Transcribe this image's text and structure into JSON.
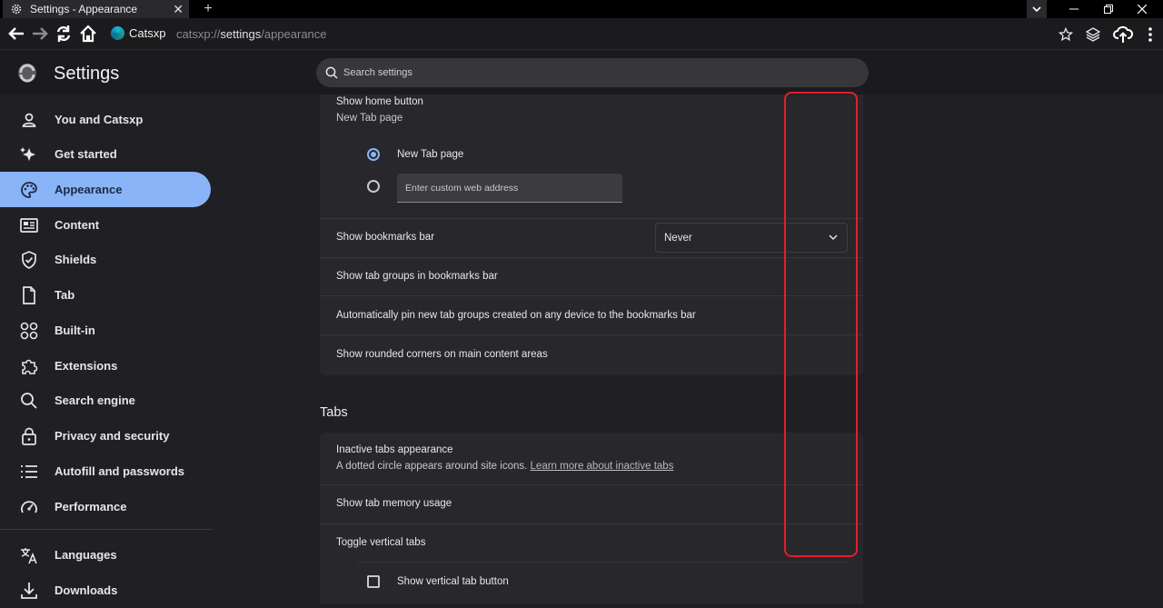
{
  "window": {
    "tab_title": "Settings - Appearance",
    "tab_close": "✕",
    "new_tab": "+"
  },
  "toolbar": {
    "brand": "Catsxp",
    "url_scheme": "catsxp://",
    "url_host": "settings",
    "url_path": "/appearance"
  },
  "header": {
    "title": "Settings",
    "search_placeholder": "Search settings"
  },
  "sidebar": {
    "items": [
      {
        "label": "You and Catsxp",
        "icon": "person-icon"
      },
      {
        "label": "Get started",
        "icon": "sparkle-icon"
      },
      {
        "label": "Appearance",
        "icon": "palette-icon",
        "active": true
      },
      {
        "label": "Content",
        "icon": "content-icon"
      },
      {
        "label": "Shields",
        "icon": "shield-icon"
      },
      {
        "label": "Tab",
        "icon": "document-icon"
      },
      {
        "label": "Built-in",
        "icon": "grid-icon"
      },
      {
        "label": "Extensions",
        "icon": "puzzle-icon"
      },
      {
        "label": "Search engine",
        "icon": "search-icon"
      },
      {
        "label": "Privacy and security",
        "icon": "lock-icon"
      },
      {
        "label": "Autofill and passwords",
        "icon": "list-icon"
      },
      {
        "label": "Performance",
        "icon": "gauge-icon"
      },
      {
        "label": "Languages",
        "icon": "translate-icon"
      },
      {
        "label": "Downloads",
        "icon": "download-icon"
      }
    ]
  },
  "appearance": {
    "home_button": {
      "label": "Show home button",
      "sub": "New Tab page",
      "option_newtab": "New Tab page",
      "custom_placeholder": "Enter custom web address"
    },
    "bookmarks_bar": {
      "label": "Show bookmarks bar",
      "value": "Never"
    },
    "tab_groups_bookmarks": {
      "label": "Show tab groups in bookmarks bar"
    },
    "auto_pin": {
      "label": "Automatically pin new tab groups created on any device to the bookmarks bar"
    },
    "rounded_corners": {
      "label": "Show rounded corners on main content areas"
    }
  },
  "tabs_section": {
    "title": "Tabs",
    "inactive": {
      "label": "Inactive tabs appearance",
      "sub": "A dotted circle appears around site icons.",
      "link": "Learn more about inactive tabs"
    },
    "memory": {
      "label": "Show tab memory usage"
    },
    "vertical": {
      "label": "Toggle vertical tabs"
    },
    "vertical_button": {
      "label": "Show vertical tab button"
    }
  },
  "colors": {
    "accent": "#8ab4f8",
    "highlight": "#e0202a",
    "background": "#1f1f24",
    "card": "#27272c"
  }
}
